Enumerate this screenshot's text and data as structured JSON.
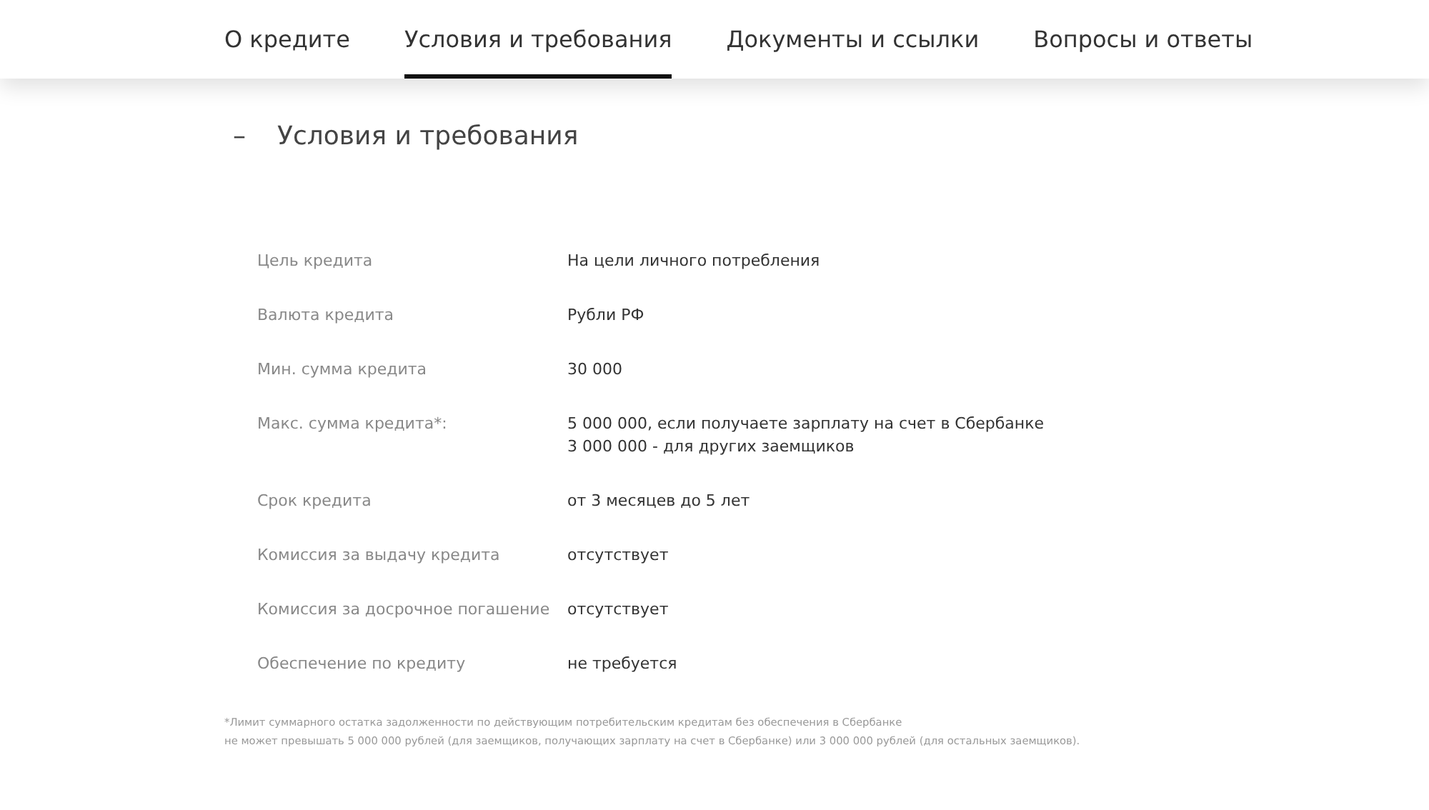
{
  "tabs": [
    {
      "label": "О кредите",
      "selected": false
    },
    {
      "label": "Условия и требования",
      "selected": true
    },
    {
      "label": "Документы и ссылки",
      "selected": false
    },
    {
      "label": "Вопросы и ответы",
      "selected": false
    }
  ],
  "section": {
    "toggle": "–",
    "title": "Условия и требования",
    "expanded": true
  },
  "conditions": [
    {
      "label": "Цель кредита",
      "value": [
        "На цели личного потребления"
      ]
    },
    {
      "label": "Валюта кредита",
      "value": [
        "Рубли РФ"
      ]
    },
    {
      "label": "Мин. сумма кредита",
      "value": [
        "30 000"
      ]
    },
    {
      "label": "Макс. сумма кредита*:",
      "value": [
        "5 000 000, если получаете зарплату на счет в Сбербанке",
        "3 000 000 - для других заемщиков"
      ]
    },
    {
      "label": "Срок кредита",
      "value": [
        "от 3 месяцев до 5 лет"
      ]
    },
    {
      "label": "Комиссия за выдачу кредита",
      "value": [
        "отсутствует"
      ]
    },
    {
      "label": "Комиссия за досрочное погашение",
      "value": [
        "отсутствует"
      ]
    },
    {
      "label": "Обеспечение по кредиту",
      "value": [
        "не требуется"
      ]
    }
  ],
  "footnote": [
    "*Лимит суммарного остатка задолженности по действующим потребительским кредитам без обеспечения в Сбербанке",
    "не может превышать 5 000 000 рублей (для заемщиков, получающих зарплату на счет в Сбербанке) или 3 000 000 рублей (для остальных заемщиков)."
  ]
}
